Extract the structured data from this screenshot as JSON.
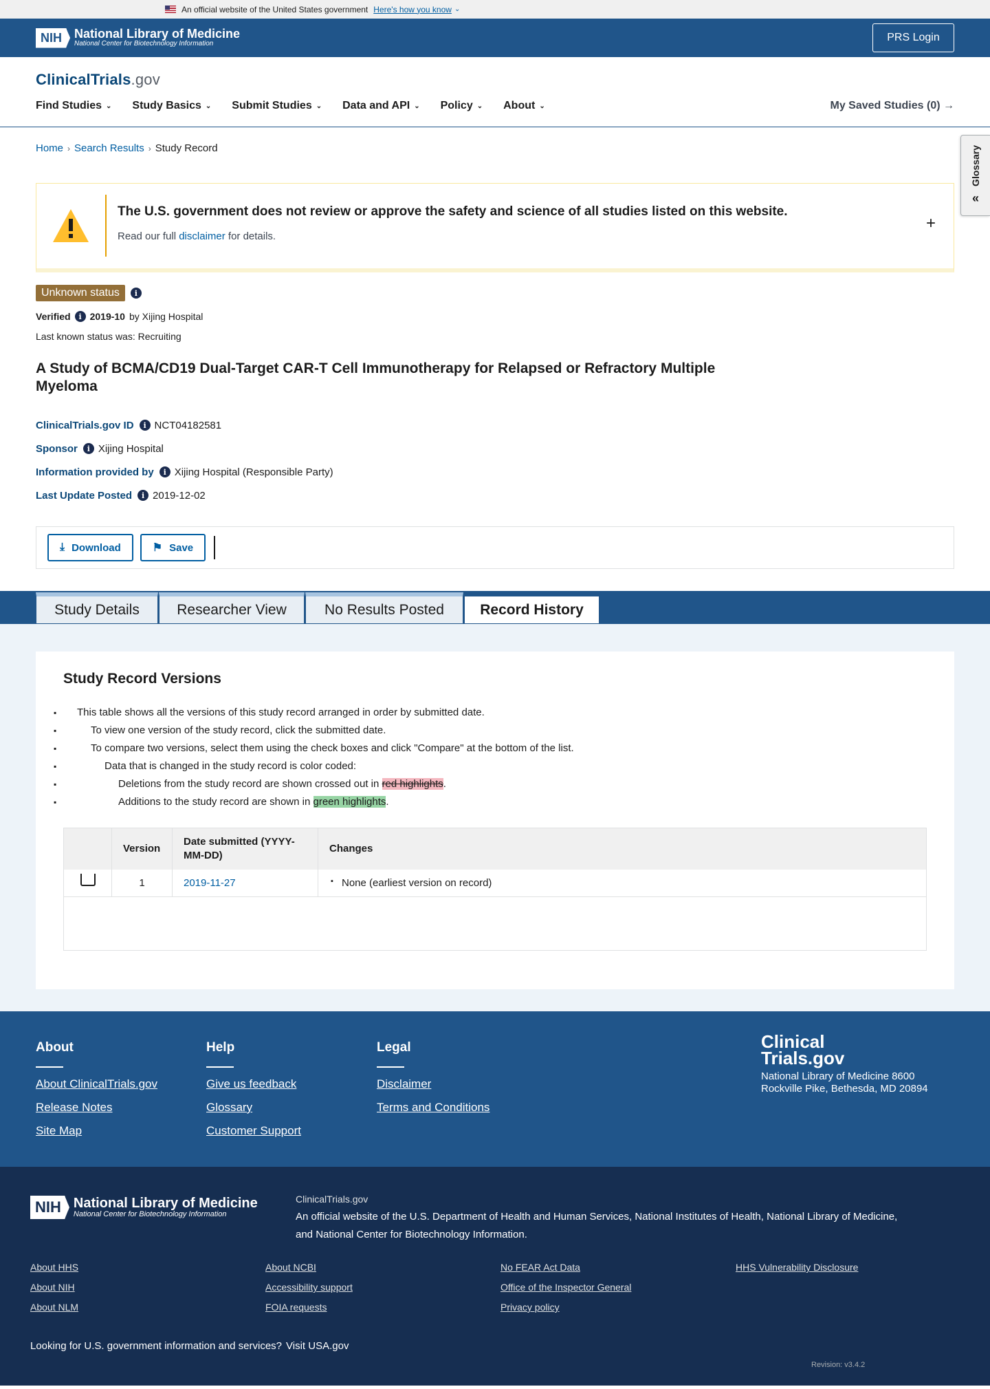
{
  "gov_banner": {
    "text": "An official website of the United States government",
    "link": "Here's how you know"
  },
  "nih_header": {
    "title": "National Library of Medicine",
    "subtitle": "National Center for Biotechnology Information",
    "badge": "NIH",
    "login": "PRS Login"
  },
  "site": {
    "logo_main": "ClinicalTrials",
    "logo_suffix": ".gov",
    "nav": [
      "Find Studies",
      "Study Basics",
      "Submit Studies",
      "Data and API",
      "Policy",
      "About"
    ],
    "saved": "My Saved Studies (0)"
  },
  "glossary": "Glossary",
  "breadcrumb": [
    "Home",
    "Search Results",
    "Study Record"
  ],
  "disclaimer": {
    "title": "The U.S. government does not review or approve the safety and science of all studies listed on this website.",
    "pre": "Read our full ",
    "link": "disclaimer",
    "post": " for details."
  },
  "status": {
    "badge": "Unknown status",
    "verified_label": "Verified",
    "verified_date": "2019-10",
    "verified_by": "by Xijing Hospital",
    "last_known": "Last known status was: Recruiting"
  },
  "study_title": "A Study of BCMA/CD19 Dual-Target CAR-T Cell Immunotherapy for Relapsed or Refractory Multiple Myeloma",
  "meta": [
    {
      "label": "ClinicalTrials.gov ID",
      "value": "NCT04182581"
    },
    {
      "label": "Sponsor",
      "value": "Xijing Hospital"
    },
    {
      "label": "Information provided by",
      "value": "Xijing Hospital (Responsible Party)"
    },
    {
      "label": "Last Update Posted",
      "value": "2019-12-02"
    }
  ],
  "actions": {
    "download": "Download",
    "save": "Save"
  },
  "tabs": [
    "Study Details",
    "Researcher View",
    "No Results Posted",
    "Record History"
  ],
  "versions": {
    "title": "Study Record Versions",
    "bullets": [
      "This table shows all the versions of this study record arranged in order by submitted date.",
      "To view one version of the study record, click the submitted date.",
      "To compare two versions, select them using the check boxes and click \"Compare\" at the bottom of the list.",
      "Data that is changed in the study record is color coded:"
    ],
    "deletions_pre": "Deletions from the study record are shown crossed out in ",
    "deletions_hl": "red highlights",
    "additions_pre": "Additions to the study record are shown in ",
    "additions_hl": "green highlights",
    "period": ".",
    "headers": [
      "Version",
      "Date submitted (YYYY-MM-DD)",
      "Changes"
    ],
    "rows": [
      {
        "version": "1",
        "date": "2019-11-27",
        "change": "None (earliest version on record)"
      }
    ]
  },
  "footer": {
    "about": {
      "title": "About",
      "links": [
        "About ClinicalTrials.gov",
        "Release Notes",
        "Site Map"
      ]
    },
    "help": {
      "title": "Help",
      "links": [
        "Give us feedback",
        "Glossary",
        "Customer Support"
      ]
    },
    "legal": {
      "title": "Legal",
      "links": [
        "Disclaimer",
        "Terms and Conditions"
      ]
    },
    "brand_line1": "Clinical",
    "brand_line2": "Trials.gov",
    "address": "National Library of Medicine 8600 Rockville Pike, Bethesda, MD 20894"
  },
  "footer_bottom": {
    "ctg": "ClinicalTrials.gov",
    "official_pre": "An official website of the ",
    "hhs": "U.S. Department of Health and Human Services",
    "nih": "National Institutes of Health",
    "nlm": "National Library of Medicine",
    "and": "and ",
    "ncbi": "National Center for Biotechnology Information",
    "links": [
      "About HHS",
      "About NCBI",
      "No FEAR Act Data",
      "HHS Vulnerability Disclosure",
      "About NIH",
      "Accessibility support",
      "Office of the Inspector General",
      "",
      "About NLM",
      "FOIA requests",
      "Privacy policy",
      ""
    ],
    "usa_text": "Looking for U.S. government information and services?",
    "usa_link": "Visit USA.gov",
    "revision": "Revision: v3.4.2"
  }
}
